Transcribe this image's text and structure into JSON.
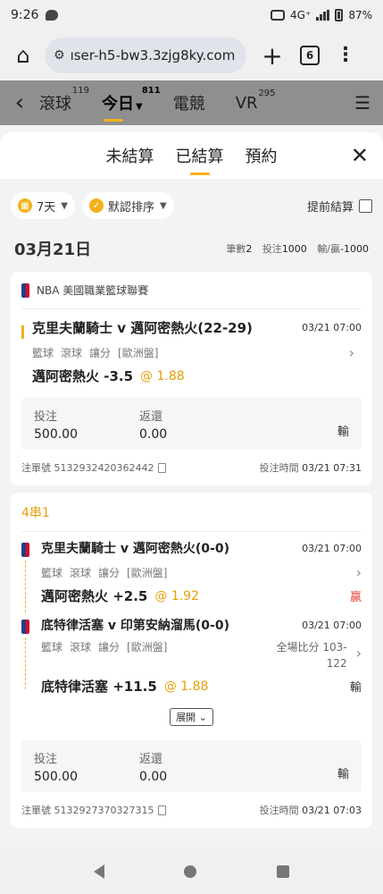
{
  "status": {
    "time": "9:26",
    "network": "4G⁺",
    "battery": "87%"
  },
  "browser": {
    "url": "ıser-h5-bw3.3zjg8ky.com",
    "tab_count": "6"
  },
  "nav": {
    "items": [
      {
        "label": "滾球",
        "count": "119"
      },
      {
        "label": "今日",
        "count": "811"
      },
      {
        "label": "電競",
        "count": ""
      },
      {
        "label": "VR",
        "count": "295"
      }
    ]
  },
  "sheet": {
    "tabs": [
      "未結算",
      "已結算",
      "預約"
    ],
    "active_tab": "已結算"
  },
  "filters": {
    "days": "7天",
    "sort": "默認排序",
    "early_settle": "提前結算"
  },
  "summary": {
    "date": "03月21日",
    "count_label": "筆數",
    "count": "2",
    "stake_label": "投注",
    "stake": "1000",
    "pl_label": "輸/贏",
    "pl": "-1000"
  },
  "labels": {
    "stake": "投注",
    "return": "返還",
    "ticket": "注單號",
    "bet_time": "投注時間",
    "expand": "展開"
  },
  "bets": [
    {
      "league": "NBA 美國職業籃球聯賽",
      "match": "克里夫蘭騎士 v 邁阿密熱火(22-29)",
      "time": "03/21 07:00",
      "tags": [
        "籃球",
        "滾球",
        "讓分",
        "[歐洲盤]"
      ],
      "pick": "邁阿密熱火 -3.5",
      "odds": "@ 1.88",
      "stake": "500.00",
      "return": "0.00",
      "result": "輸",
      "ticket": "5132932420362442",
      "bet_time": "03/21 07:31"
    }
  ],
  "combo": {
    "title": "4串1",
    "legs": [
      {
        "match": "克里夫蘭騎士 v 邁阿密熱火(0-0)",
        "time": "03/21 07:00",
        "tags": [
          "籃球",
          "滾球",
          "讓分",
          "[歐洲盤]"
        ],
        "pick": "邁阿密熱火 +2.5",
        "odds": "@ 1.92",
        "result": "贏",
        "score": ""
      },
      {
        "match": "底特律活塞 v 印第安納溜馬(0-0)",
        "time": "03/21 07:00",
        "tags": [
          "籃球",
          "滾球",
          "讓分",
          "[歐洲盤]"
        ],
        "pick": "底特律活塞 +11.5",
        "odds": "@ 1.88",
        "result": "輸",
        "score_label": "全場比分 103-",
        "score_value": "122"
      }
    ],
    "stake": "500.00",
    "return": "0.00",
    "result": "輸",
    "ticket": "5132927370327315",
    "bet_time": "03/21 07:03"
  },
  "colors": {
    "accent": "#f3b21a",
    "win": "#e5483b",
    "odds": "#e3a008"
  }
}
